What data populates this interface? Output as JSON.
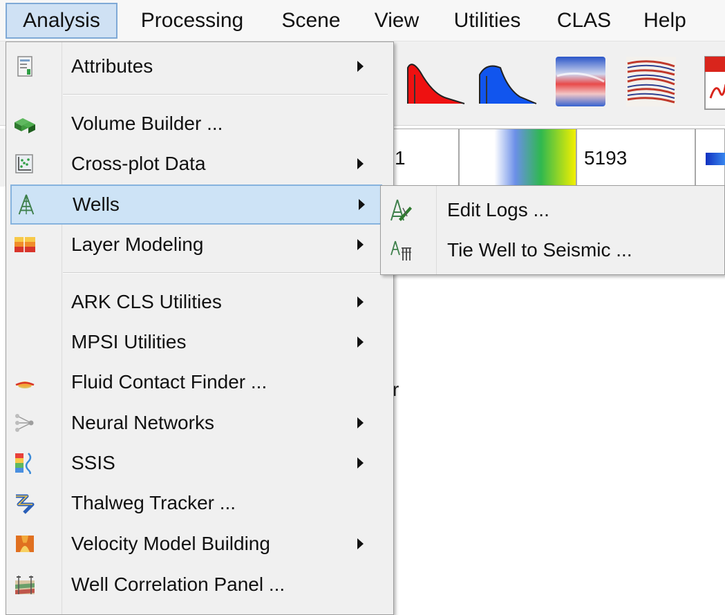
{
  "menubar": {
    "items": [
      {
        "label": "Analysis",
        "active": true
      },
      {
        "label": "Processing",
        "active": false
      },
      {
        "label": "Scene",
        "active": false
      },
      {
        "label": "View",
        "active": false
      },
      {
        "label": "Utilities",
        "active": false
      },
      {
        "label": "CLAS",
        "active": false
      },
      {
        "label": "Help",
        "active": false
      }
    ]
  },
  "background": {
    "field_1_value": "1",
    "field_2_value": "5193",
    "canvas_letter": "r"
  },
  "toolbar_icons": [
    "red-amplitude-spectrum-icon",
    "blue-amplitude-spectrum-icon",
    "seismic-colormap-icon",
    "seismic-section-icon",
    "pdf-icon"
  ],
  "analysis_menu": {
    "items": [
      {
        "label": "Attributes",
        "icon": "attributes-icon",
        "submenu": true
      },
      {
        "label": "Volume Builder ...",
        "icon": "volume-builder-icon",
        "submenu": false
      },
      {
        "label": "Cross-plot Data",
        "icon": "cross-plot-icon",
        "submenu": true
      },
      {
        "label": "Wells",
        "icon": "well-derrick-icon",
        "submenu": true,
        "highlighted": true
      },
      {
        "label": "Layer Modeling",
        "icon": "layer-modeling-icon",
        "submenu": true
      },
      {
        "label": "ARK CLS Utilities",
        "icon": "",
        "submenu": true
      },
      {
        "label": "MPSI Utilities",
        "icon": "",
        "submenu": true
      },
      {
        "label": "Fluid Contact Finder ...",
        "icon": "fluid-contact-icon",
        "submenu": false
      },
      {
        "label": "Neural Networks",
        "icon": "neural-network-icon",
        "submenu": true
      },
      {
        "label": "SSIS",
        "icon": "ssis-icon",
        "submenu": true
      },
      {
        "label": "Thalweg Tracker ...",
        "icon": "thalweg-tracker-icon",
        "submenu": false
      },
      {
        "label": "Velocity Model Building",
        "icon": "velocity-model-icon",
        "submenu": true
      },
      {
        "label": "Well Correlation Panel ...",
        "icon": "well-correlation-icon",
        "submenu": false
      }
    ]
  },
  "wells_submenu": {
    "items": [
      {
        "label": "Edit Logs ...",
        "icon": "edit-logs-icon"
      },
      {
        "label": "Tie Well to Seismic ...",
        "icon": "tie-well-icon"
      }
    ]
  }
}
